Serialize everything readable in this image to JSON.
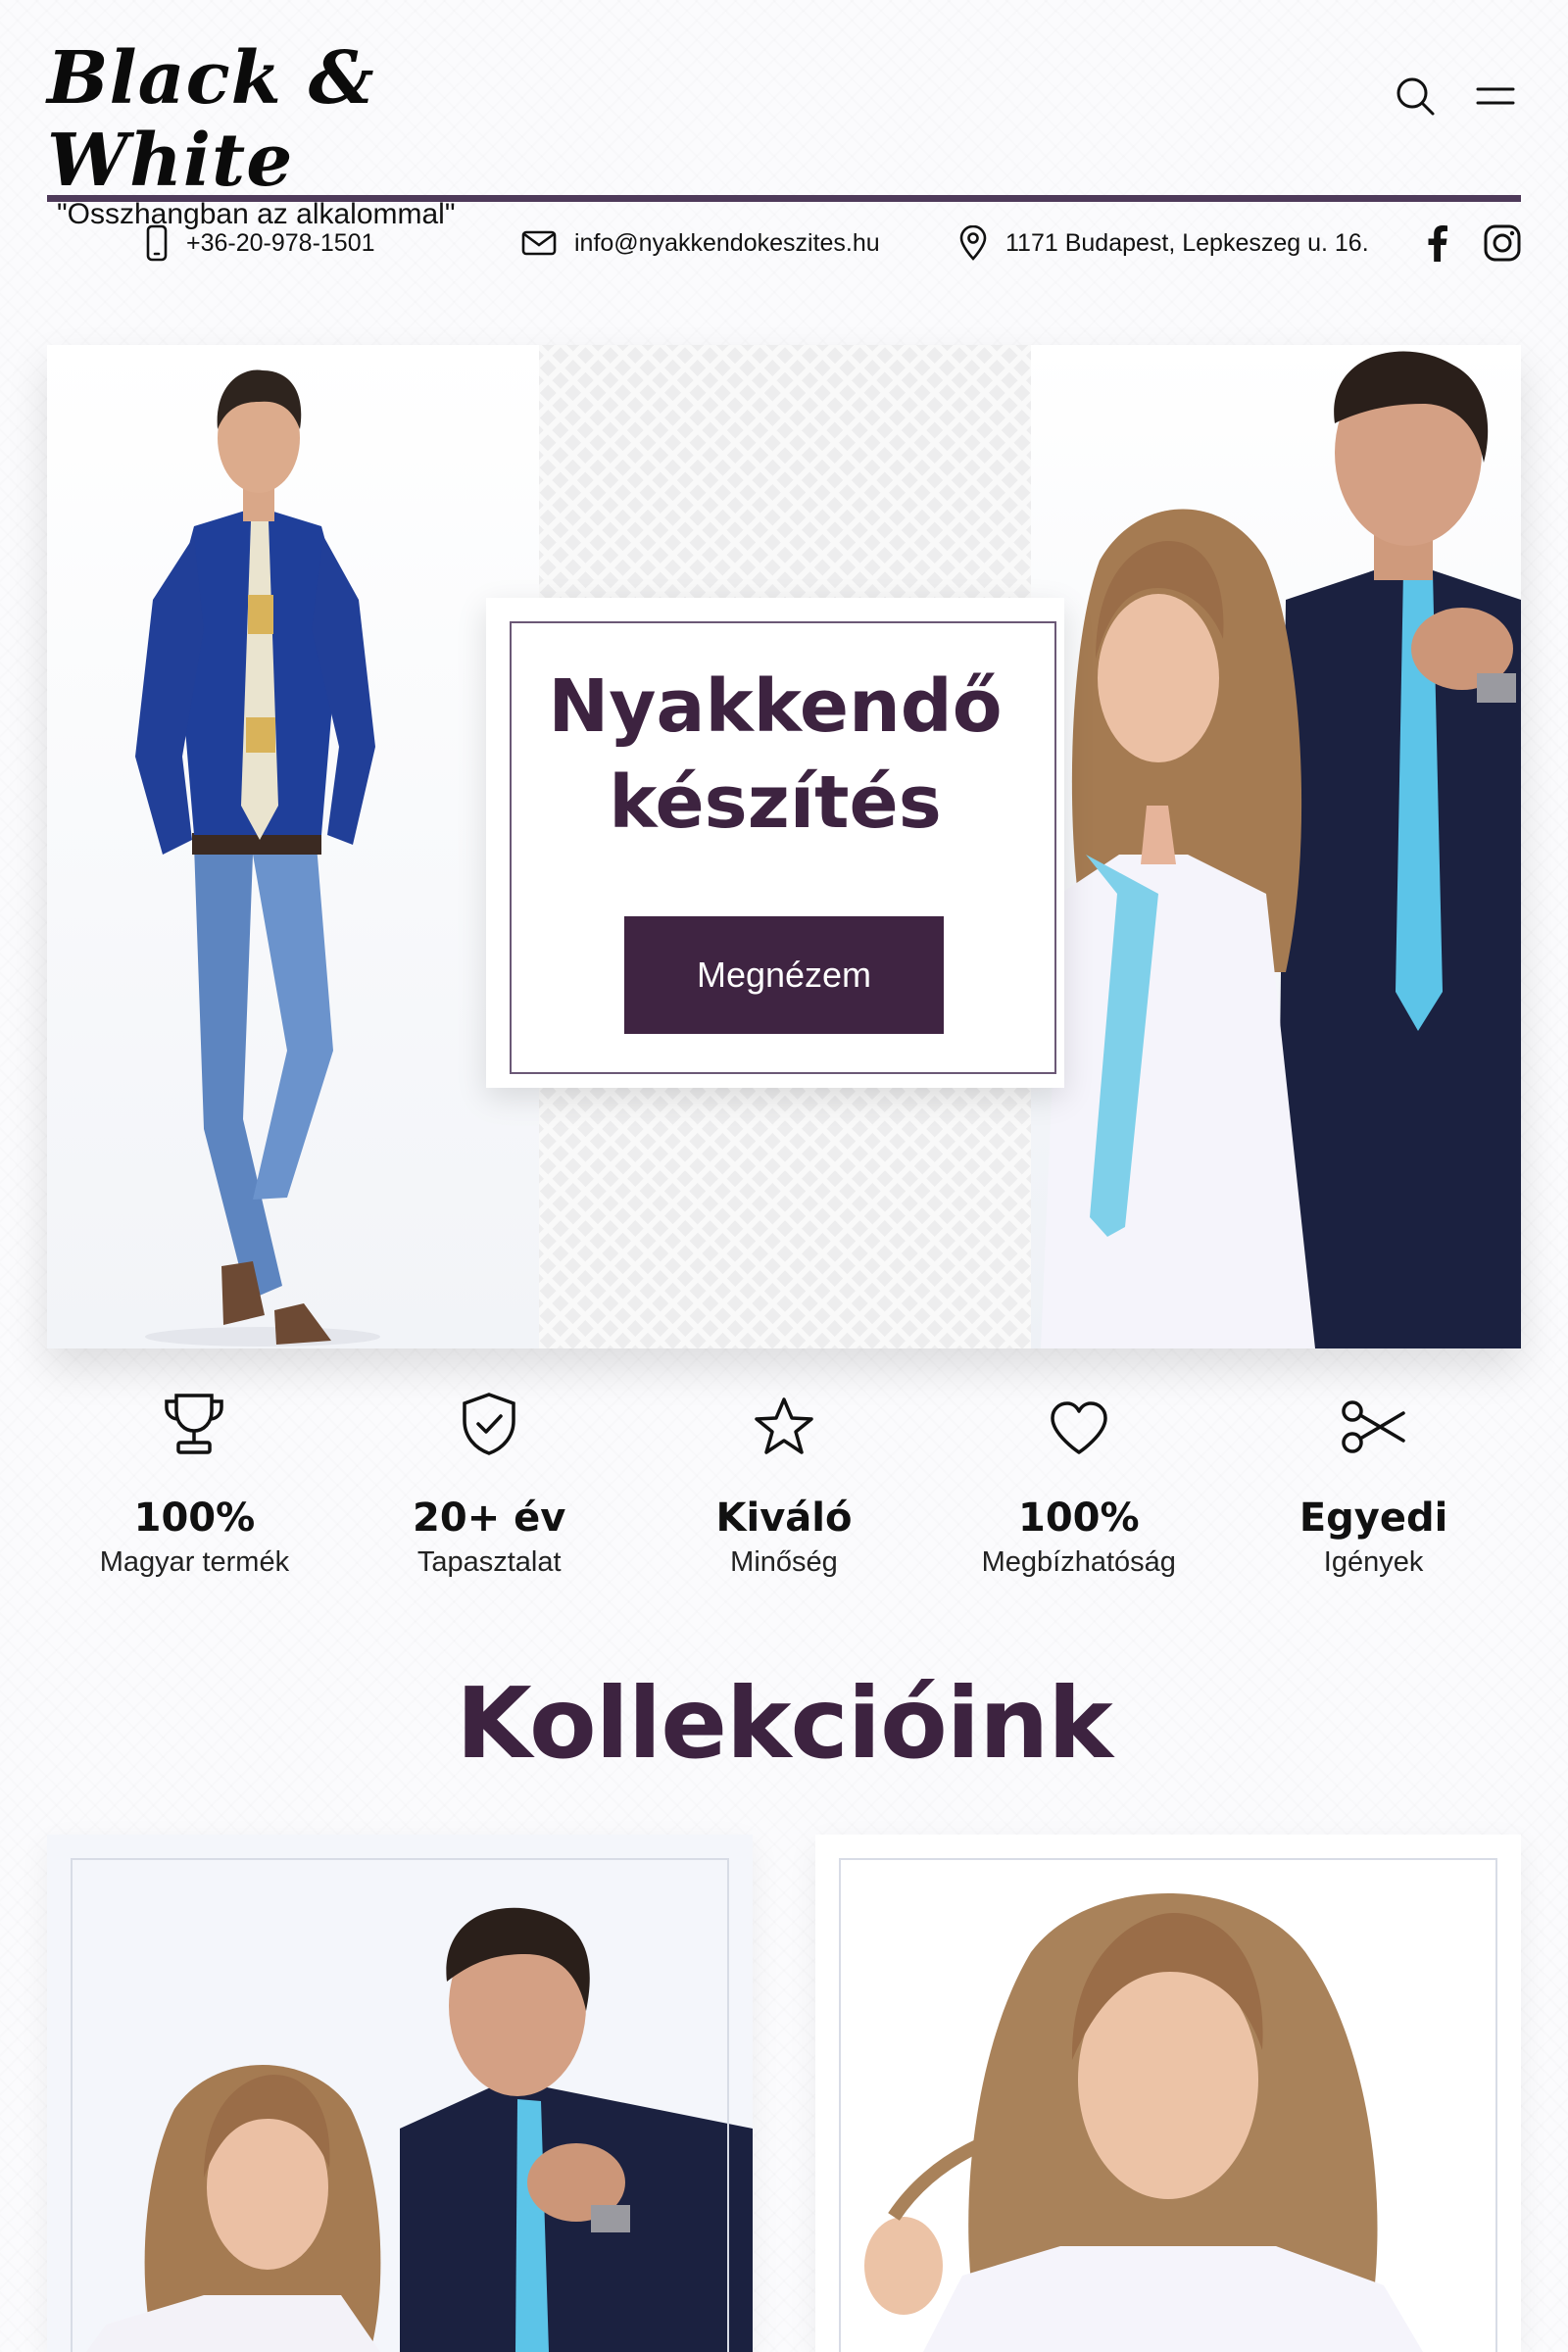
{
  "header": {
    "brand": "Black & White",
    "tagline": "\"Összhangban az alkalommal\"",
    "icons": [
      "search-icon",
      "menu-icon"
    ]
  },
  "contact": {
    "phone": "+36-20-978-1501",
    "email": "info@nyakkendokeszites.hu",
    "address": "1171 Budapest, Lepkeszeg u. 16.",
    "social": [
      "facebook-icon",
      "instagram-icon"
    ]
  },
  "hero": {
    "title_line1": "Nyakkendő",
    "title_line2": "készítés",
    "button_label": "Megnézem"
  },
  "features": [
    {
      "icon": "trophy-icon",
      "value": "100%",
      "label": "Magyar termék"
    },
    {
      "icon": "shield-check-icon",
      "value": "20+ év",
      "label": "Tapasztalat"
    },
    {
      "icon": "star-icon",
      "value": "Kiváló",
      "label": "Minőség"
    },
    {
      "icon": "heart-icon",
      "value": "100%",
      "label": "Megbízhatóság"
    },
    {
      "icon": "scissors-icon",
      "value": "Egyedi",
      "label": "Igények"
    }
  ],
  "collections": {
    "title": "Kollekcióink"
  },
  "colors": {
    "brand_purple": "#3f2442",
    "rule_purple": "#4e3a5a"
  }
}
